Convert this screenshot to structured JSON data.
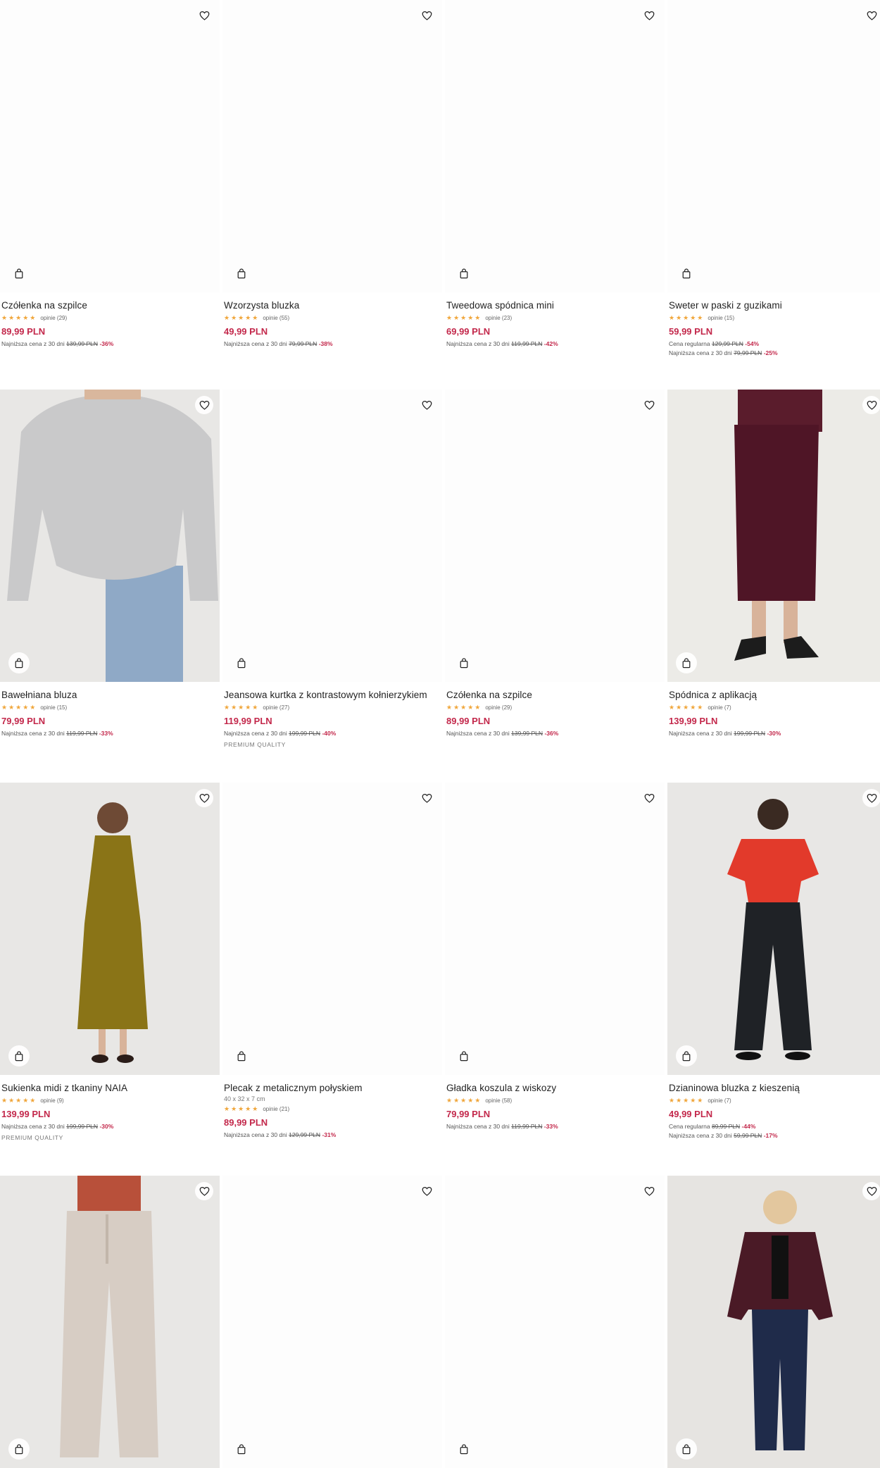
{
  "icons": {
    "favorite": "heart-icon",
    "add_to_cart": "shopping-bag-icon",
    "rating": "star-icon"
  },
  "colors": {
    "price": "#c3284b",
    "stars": "#f0a63b",
    "text": "#222222"
  },
  "products": [
    {
      "name": "Czółenka na szpilce",
      "stars": "★★★★★",
      "reviews": "opinie (29)",
      "price": "89,99 PLN",
      "lowest_label": "Najniższa cena z 30 dni",
      "lowest_old": "139,99 PLN",
      "lowest_disc": "-36%"
    },
    {
      "name": "Wzorzysta bluzka",
      "stars": "★★★★★",
      "reviews": "opinie (55)",
      "price": "49,99 PLN",
      "lowest_label": "Najniższa cena z 30 dni",
      "lowest_old": "79,99 PLN",
      "lowest_disc": "-38%"
    },
    {
      "name": "Tweedowa spódnica mini",
      "stars": "★★★★★",
      "reviews": "opinie (23)",
      "price": "69,99 PLN",
      "lowest_label": "Najniższa cena z 30 dni",
      "lowest_old": "119,99 PLN",
      "lowest_disc": "-42%"
    },
    {
      "name": "Sweter w paski z guzikami",
      "stars": "★★★★★",
      "reviews": "opinie (15)",
      "price": "59,99 PLN",
      "regular_label": "Cena regularna",
      "regular_old": "129,99 PLN",
      "regular_disc": "-54%",
      "lowest_label": "Najniższa cena z 30 dni",
      "lowest_old": "79,99 PLN",
      "lowest_disc": "-25%"
    },
    {
      "name": "Bawełniana bluza",
      "stars": "★★★★★",
      "reviews": "opinie (15)",
      "price": "79,99 PLN",
      "lowest_label": "Najniższa cena z 30 dni",
      "lowest_old": "119,99 PLN",
      "lowest_disc": "-33%"
    },
    {
      "name": "Jeansowa kurtka z kontrastowym kołnierzykiem",
      "stars": "★★★★★",
      "reviews": "opinie (27)",
      "price": "119,99 PLN",
      "lowest_label": "Najniższa cena z 30 dni",
      "lowest_old": "199,99 PLN",
      "lowest_disc": "-40%",
      "badge": "PREMIUM QUALITY"
    },
    {
      "name": "Czółenka na szpilce",
      "stars": "★★★★★",
      "reviews": "opinie (29)",
      "price": "89,99 PLN",
      "lowest_label": "Najniższa cena z 30 dni",
      "lowest_old": "139,99 PLN",
      "lowest_disc": "-36%"
    },
    {
      "name": "Spódnica z aplikacją",
      "stars": "★★★★★",
      "reviews": "opinie (7)",
      "price": "139,99 PLN",
      "lowest_label": "Najniższa cena z 30 dni",
      "lowest_old": "199,99 PLN",
      "lowest_disc": "-30%"
    },
    {
      "name": "Sukienka midi z tkaniny NAIA",
      "stars": "★★★★★",
      "reviews": "opinie (9)",
      "price": "139,99 PLN",
      "lowest_label": "Najniższa cena z 30 dni",
      "lowest_old": "199,99 PLN",
      "lowest_disc": "-30%",
      "badge": "PREMIUM QUALITY"
    },
    {
      "name": "Plecak z metalicznym połyskiem",
      "size": "40 x 32 x 7 cm",
      "stars": "★★★★★",
      "reviews": "opinie (21)",
      "price": "89,99 PLN",
      "lowest_label": "Najniższa cena z 30 dni",
      "lowest_old": "129,99 PLN",
      "lowest_disc": "-31%"
    },
    {
      "name": "Gładka koszula z wiskozy",
      "stars": "★★★★★",
      "reviews": "opinie (58)",
      "price": "79,99 PLN",
      "lowest_label": "Najniższa cena z 30 dni",
      "lowest_old": "119,99 PLN",
      "lowest_disc": "-33%"
    },
    {
      "name": "Dzianinowa bluzka z kieszenią",
      "stars": "★★★★★",
      "reviews": "opinie (7)",
      "price": "49,99 PLN",
      "regular_label": "Cena regularna",
      "regular_old": "89,99 PLN",
      "regular_disc": "-44%",
      "lowest_label": "Najniższa cena z 30 dni",
      "lowest_old": "59,99 PLN",
      "lowest_disc": "-17%"
    },
    {
      "name": "",
      "price": ""
    },
    {
      "name": "",
      "price": ""
    },
    {
      "name": "",
      "price": ""
    },
    {
      "name": "",
      "price": ""
    }
  ]
}
